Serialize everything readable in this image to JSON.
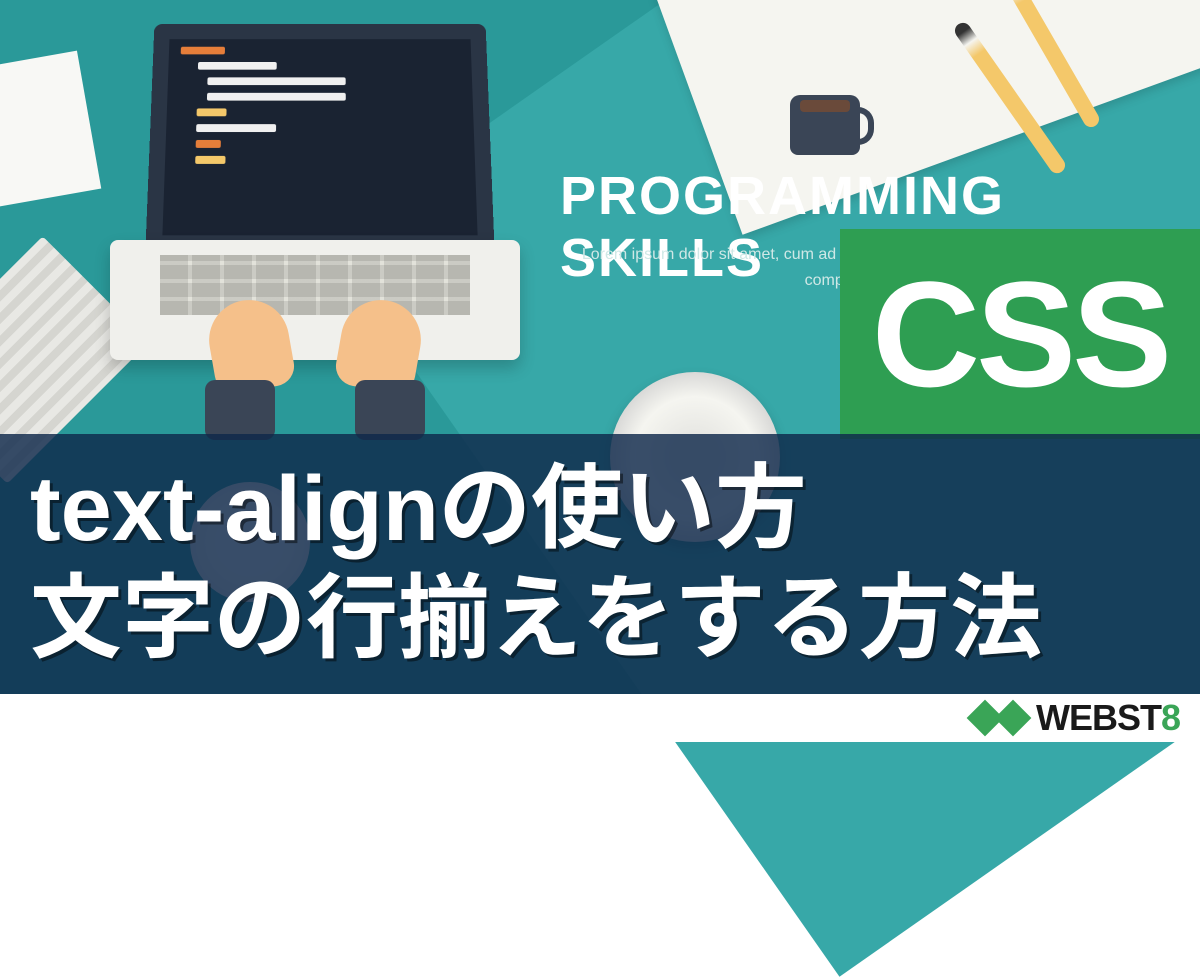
{
  "background": {
    "heading": "PROGRAMMING SKILLS",
    "lorem": "Lorem ipsum dolor sit amet, cum ad quidam deserunt. Duo dicta vertam dictas et, complectitur cu. Si"
  },
  "badge": {
    "label": "CSS"
  },
  "title": {
    "line1": "text-alignの使い方",
    "line2": "文字の行揃えをする方法"
  },
  "logo": {
    "text_part1": "WEBST",
    "text_part2": "8"
  },
  "colors": {
    "teal": "#2a9999",
    "green_badge": "#2e9e52",
    "overlay": "rgba(15,40,75,0.82)",
    "logo_green": "#3aa557"
  }
}
